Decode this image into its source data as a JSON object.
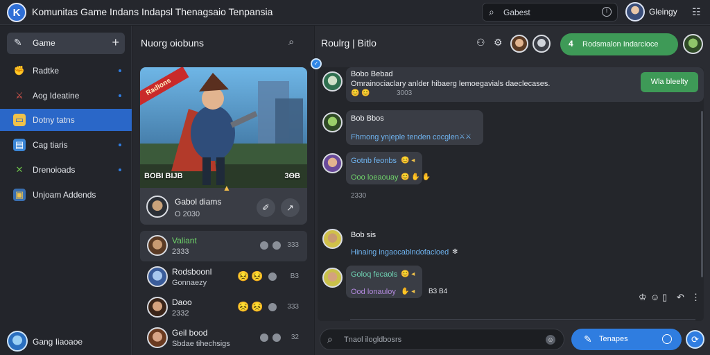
{
  "titlebar": {
    "logo_letter": "K",
    "title": "Komunitas Game Indans Indapsl Thenagsaio Tenpansia",
    "search_placeholder": "Gabest",
    "search_icon": "search-icon",
    "user_name": "Gleingy"
  },
  "sidebar": {
    "top_item": {
      "label": "Game",
      "icon": "gamepad-icon"
    },
    "items": [
      {
        "label": "Radtke",
        "icon": "trophy-icon"
      },
      {
        "label": "Aog Ideatine",
        "icon": "sword-icon"
      },
      {
        "label": "Dotny tatns",
        "icon": "folder-icon"
      },
      {
        "label": "Cag tiaris",
        "icon": "chat-icon"
      },
      {
        "label": "Drenoioads",
        "icon": "crossed-swords-icon"
      },
      {
        "label": "Unjoam Addends",
        "icon": "box-icon"
      }
    ],
    "active_index": 2,
    "footer_name": "Gang Iiaoaoe"
  },
  "middle": {
    "title": "Nuorg oiobuns",
    "feature": {
      "ribbon": "Radions",
      "stat_left": "BOBI BIJB",
      "stat_right": "3ΘB",
      "name": "Gabol diams",
      "sub": "O 2030"
    },
    "players": [
      {
        "name": "Valiant",
        "sub": "2333",
        "count": "333"
      },
      {
        "name": "Rodsboonl",
        "sub": "Gonnaezy",
        "count": "B3"
      },
      {
        "name": "Daoo",
        "sub": "2332",
        "count": "333"
      },
      {
        "name": "Geil bood",
        "sub": "Sbdae tihechsigs",
        "count": "32"
      }
    ]
  },
  "chat": {
    "title": "Roulrg | Bitlo",
    "notify_count": "4",
    "notify_text": "Rodsmalon Indarcioce",
    "join_label": "Wla bleelty",
    "messages": [
      {
        "author": "Bobo Bebad",
        "text": "Omrainociaclary anlder hibaerg lemoegavials daeclecases.",
        "meta": "3003"
      },
      {
        "author": "Bob Bbos",
        "text": "Fhmong ynjeple tenden cocglen",
        "meta": ""
      },
      {
        "author": "Gotnb feonbs",
        "text": "Ooo loeaouay",
        "meta": "2330"
      },
      {
        "author": "Bob sis",
        "text": "Hinaing ingaocablndofacloed",
        "meta": ""
      },
      {
        "author": "Goloq fecaols",
        "text": "Ood lonauloy",
        "meta": "B3 B4"
      }
    ],
    "composer_placeholder": "Tnaol ilogldbosrs",
    "send_label": "Tenapes"
  }
}
